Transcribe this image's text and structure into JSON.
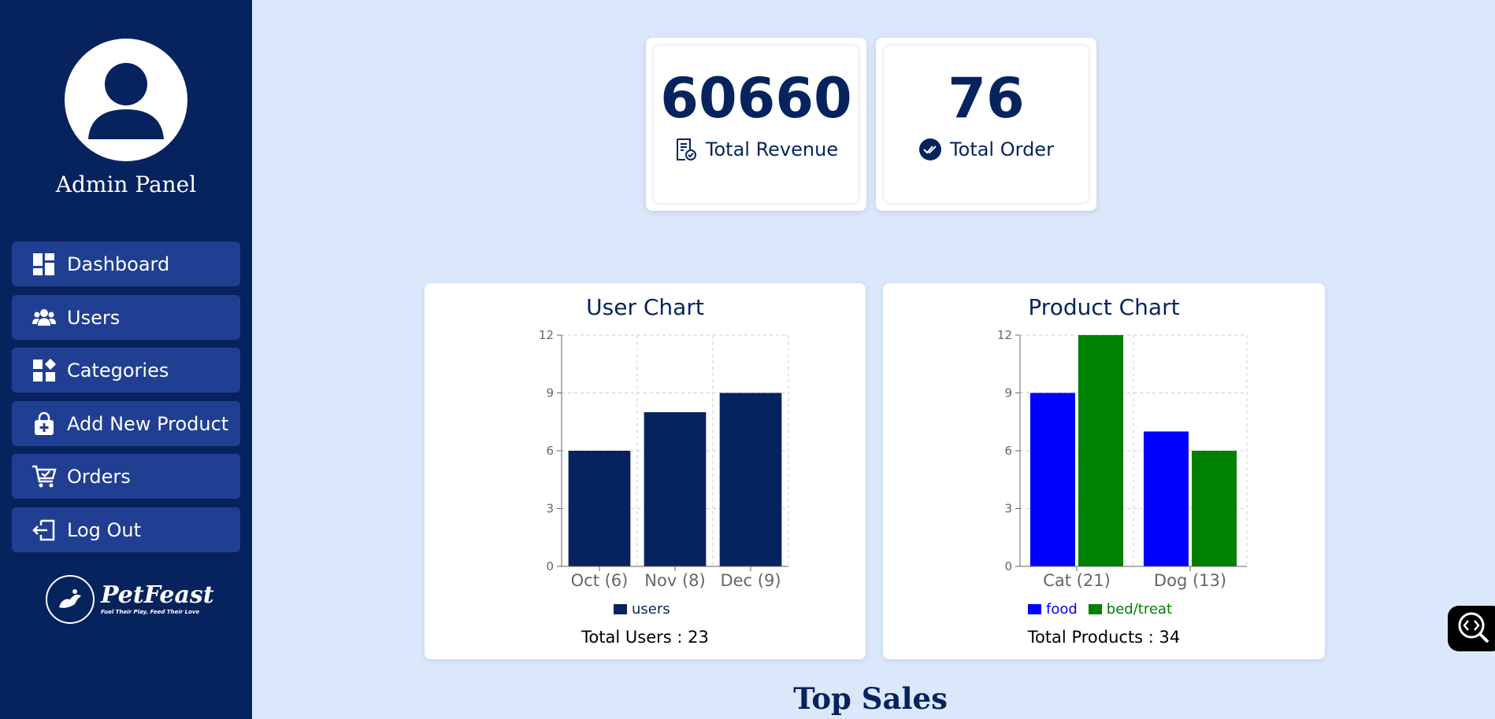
{
  "sidebar": {
    "title": "Admin Panel",
    "items": [
      {
        "label": "Dashboard",
        "icon": "dashboard-icon"
      },
      {
        "label": "Users",
        "icon": "users-icon"
      },
      {
        "label": "Categories",
        "icon": "categories-icon"
      },
      {
        "label": "Add New Product",
        "icon": "shopping-bag-plus-icon"
      },
      {
        "label": "Orders",
        "icon": "cart-check-icon"
      },
      {
        "label": "Log Out",
        "icon": "logout-icon"
      }
    ],
    "brand": {
      "name": "PetFeast",
      "tagline": "Fuel Their Play, Feed Their Love"
    }
  },
  "stats": {
    "revenue": {
      "value": "60660",
      "label": "Total Revenue",
      "icon": "receipt-check-icon"
    },
    "orders": {
      "value": "76",
      "label": "Total Order",
      "icon": "double-check-circle-icon"
    }
  },
  "user_chart": {
    "title": "User Chart",
    "total": "Total Users : 23"
  },
  "product_chart": {
    "title": "Product Chart",
    "total": "Total Products : 34"
  },
  "section_title": "Top Sales",
  "colors": {
    "navy": "#07235e",
    "nav_item": "#213f92",
    "background": "#dbe8fc",
    "food": "#0000ff",
    "bed_treat": "#008000"
  },
  "chart_data": [
    {
      "type": "bar",
      "title": "User Chart",
      "categories": [
        "Oct (6)",
        "Nov (8)",
        "Dec (9)"
      ],
      "series": [
        {
          "name": "users",
          "values": [
            6,
            8,
            9
          ],
          "color": "#07235e"
        }
      ],
      "ylim": [
        0,
        12
      ],
      "yticks": [
        0,
        3,
        6,
        9,
        12
      ],
      "grid": true,
      "legend": "bottom"
    },
    {
      "type": "bar",
      "title": "Product Chart",
      "categories": [
        "Cat (21)",
        "Dog (13)"
      ],
      "series": [
        {
          "name": "food",
          "values": [
            9,
            7
          ],
          "color": "#0000ff"
        },
        {
          "name": "bed/treat",
          "values": [
            12,
            6
          ],
          "color": "#008000"
        }
      ],
      "ylim": [
        0,
        12
      ],
      "yticks": [
        0,
        3,
        6,
        9,
        12
      ],
      "grid": true,
      "legend": "bottom"
    }
  ]
}
